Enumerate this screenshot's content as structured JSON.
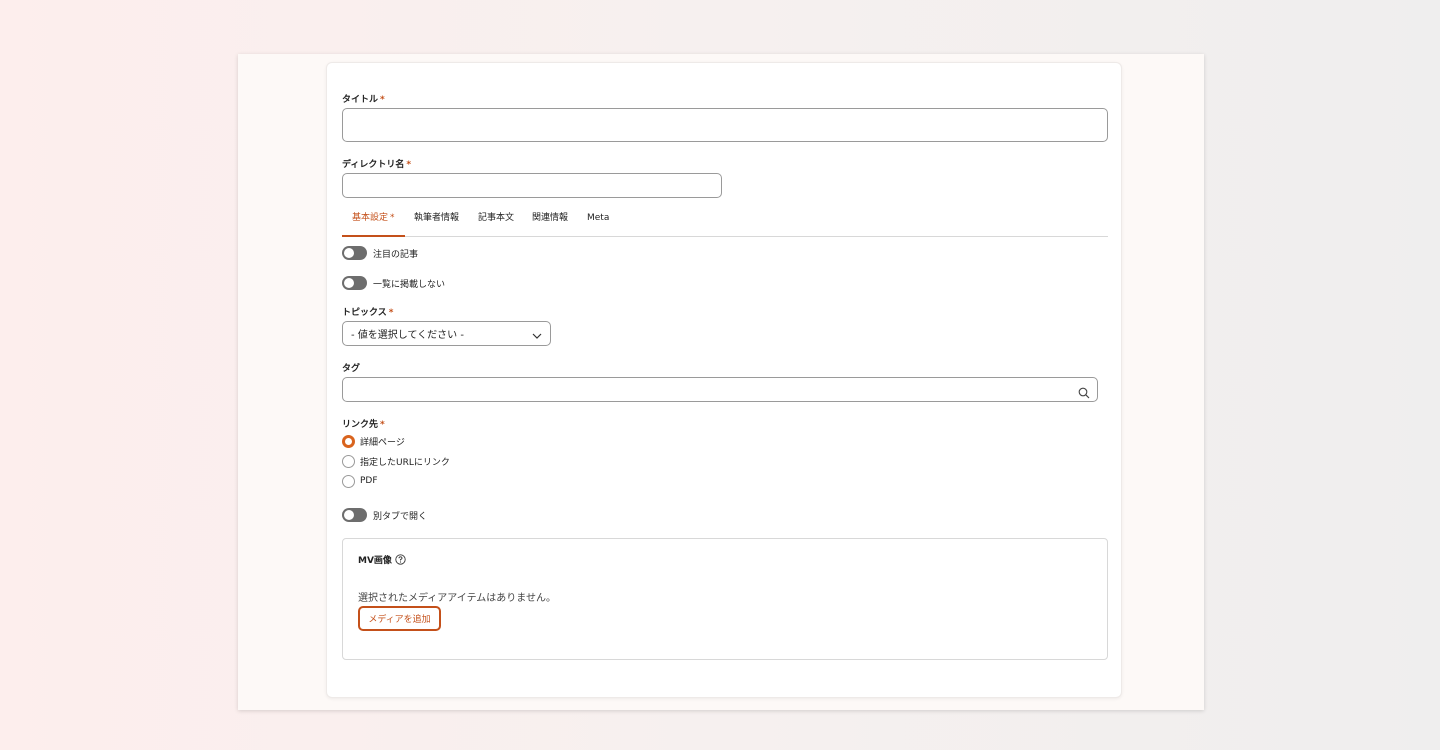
{
  "form": {
    "title_label": "タイトル",
    "title_value": "",
    "directory_label": "ディレクトリ名",
    "directory_value": "",
    "required_mark": "*",
    "tabs": [
      {
        "label": "基本設定",
        "required": "*",
        "active": true
      },
      {
        "label": "執筆者情報"
      },
      {
        "label": "記事本文"
      },
      {
        "label": "関連情報"
      },
      {
        "label": "Meta"
      }
    ],
    "toggles": [
      {
        "label": "注目の記事",
        "checked": false
      },
      {
        "label": "一覧に掲載しない",
        "checked": false
      },
      {
        "label": "別タブで開く",
        "checked": false
      }
    ],
    "topics_label": "トピックス",
    "topics_selected": "- 値を選択してください -",
    "tag_label": "タグ",
    "tag_value": "",
    "link_label": "リンク先",
    "link_options": [
      {
        "label": "詳細ページ",
        "checked": true
      },
      {
        "label": "指定したURLにリンク",
        "checked": false
      },
      {
        "label": "PDF",
        "checked": false
      }
    ],
    "media": {
      "title": "MV画像",
      "empty_text": "選択されたメディアアイテムはありません。",
      "add_button": "メディアを追加"
    }
  },
  "icons": {
    "topics_chevron": "chevron-down-icon",
    "tag_search": "search-icon",
    "media_help": "help-icon"
  },
  "colors": {
    "accent": "#c4501a",
    "toggle_off": "#6d6d6d",
    "radio_checked": "#d9641e"
  }
}
